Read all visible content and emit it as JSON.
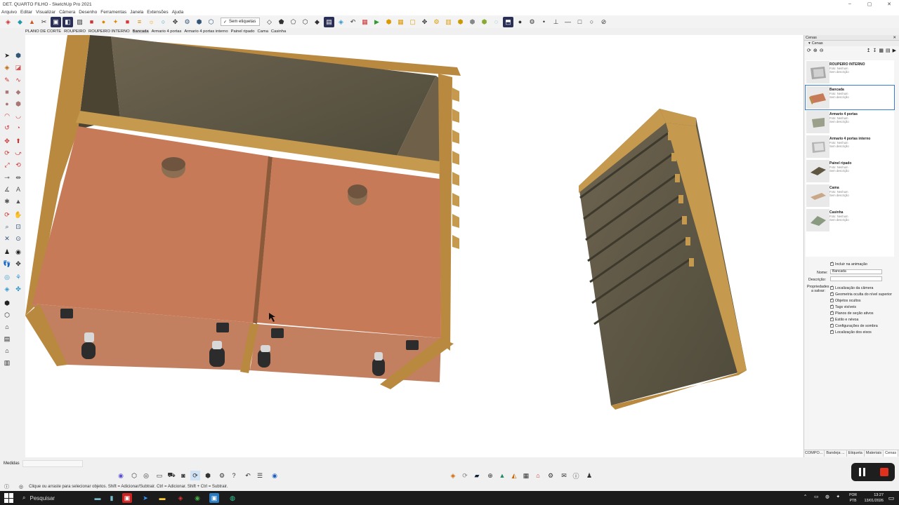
{
  "window": {
    "title": "DET. QUARTO FILHO - SketchUp Pro 2021",
    "controls": [
      "–",
      "▢",
      "✕"
    ]
  },
  "menu": [
    "Arquivo",
    "Editar",
    "Visualizar",
    "Câmera",
    "Desenho",
    "Ferramentas",
    "Janela",
    "Extensões",
    "Ajuda"
  ],
  "toolbar": {
    "tag_select": "Sem etiquetas"
  },
  "scene_tabs": [
    "PLANO DE CORTE",
    "ROUPEIRO",
    "ROUPEIRO INTERNO",
    "Bancada",
    "Armario 4 portas",
    "Armario 4 portas interno",
    "Painel ripado",
    "Cama",
    "Casinha"
  ],
  "active_scene_tab": "Bancada",
  "panel": {
    "header": "Cenas",
    "subheader": "Cenas",
    "scenes": [
      {
        "name": "ROUPEIRO INTERNO",
        "photo": "Foto: Nenhum",
        "desc": "Sem descrição",
        "selected": false
      },
      {
        "name": "Bancada",
        "photo": "Foto: Nenhum",
        "desc": "Sem descrição",
        "selected": true
      },
      {
        "name": "Armario 4 portas",
        "photo": "Foto: Nenhum",
        "desc": "Sem descrição",
        "selected": false
      },
      {
        "name": "Armario 4 portas interno",
        "photo": "Foto: Nenhum",
        "desc": "Sem descrição",
        "selected": false
      },
      {
        "name": "Painel ripado",
        "photo": "Foto: Nenhum",
        "desc": "Sem descrição",
        "selected": false
      },
      {
        "name": "Cama",
        "photo": "Foto: Nenhum",
        "desc": "Sem descrição",
        "selected": false
      },
      {
        "name": "Casinha",
        "photo": "Foto: Nenhum",
        "desc": "Sem descrição",
        "selected": false
      }
    ],
    "include_animation": "Incluir na animação",
    "name_label": "Nome:",
    "name_value": "Bancada",
    "desc_label": "Descrição:",
    "desc_value": "",
    "props_label_1": "Propriedades",
    "props_label_2": "a salvar:",
    "properties": [
      "Localização da câmera",
      "Geometria oculta do nível superior",
      "Objetos ocultos",
      "Tags visíveis",
      "Planos de seção ativos",
      "Estilo e névoa",
      "Configurações de sombra",
      "Localização dos eixos"
    ]
  },
  "panel_tabs": [
    "COMPO...",
    "Bandeja ...",
    "Etiqueta",
    "Materiais",
    "Cenas"
  ],
  "active_panel_tab": "Cenas",
  "measurements_label": "Medidas",
  "status_text": "Clique ou arraste para selecionar objetos. Shift = Adicionar/Subtrair. Ctrl = Adicionar. Shift + Ctrl = Subtrair.",
  "taskbar": {
    "search": "Pesquisar",
    "lang_1": "POR",
    "lang_2": "PTB",
    "time": "13:27",
    "date": "13/01/2026"
  },
  "colors": {
    "wood_frame": "#b8893f",
    "drawer_front": "#c77a57",
    "dark_wood": "#5f5742",
    "selection_blue": "#3a7bd5"
  }
}
